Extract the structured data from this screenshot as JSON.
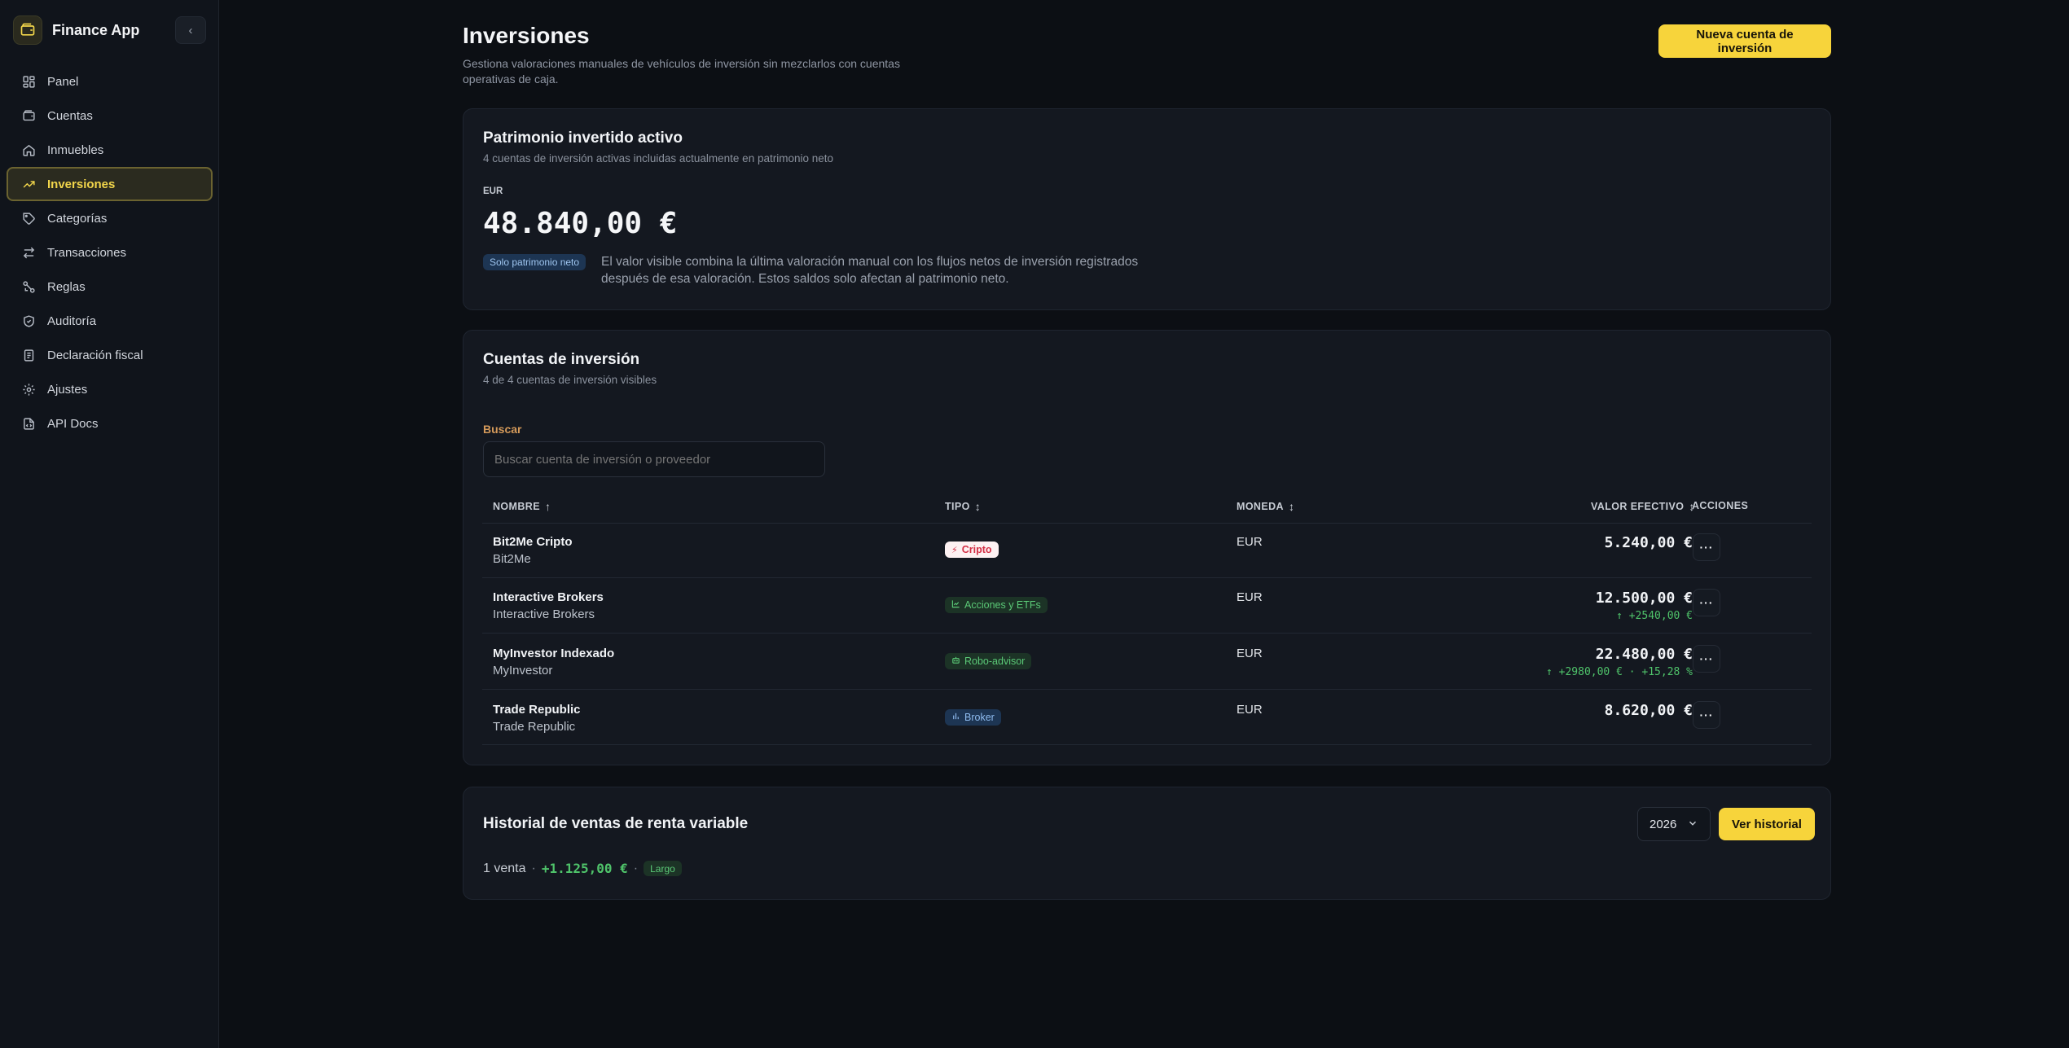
{
  "app": {
    "name": "Finance App",
    "collapse_icon": "‹"
  },
  "sidebar": {
    "items": [
      {
        "label": "Panel",
        "icon": "grid-icon"
      },
      {
        "label": "Cuentas",
        "icon": "wallet-icon"
      },
      {
        "label": "Inmuebles",
        "icon": "home-icon"
      },
      {
        "label": "Inversiones",
        "icon": "trending-up-icon",
        "active": true
      },
      {
        "label": "Categorías",
        "icon": "tag-icon"
      },
      {
        "label": "Transacciones",
        "icon": "arrows-swap-icon"
      },
      {
        "label": "Reglas",
        "icon": "workflow-icon"
      },
      {
        "label": "Auditoría",
        "icon": "shield-check-icon"
      },
      {
        "label": "Declaración fiscal",
        "icon": "receipt-icon"
      },
      {
        "label": "Ajustes",
        "icon": "gear-icon"
      },
      {
        "label": "API Docs",
        "icon": "file-code-icon"
      }
    ]
  },
  "header": {
    "title": "Inversiones",
    "subtitle": "Gestiona valoraciones manuales de vehículos de inversión sin mezclarlos con cuentas operativas de caja.",
    "new_button": "Nueva cuenta de inversión"
  },
  "summary": {
    "title": "Patrimonio invertido activo",
    "subtitle": "4 cuentas de inversión activas incluidas actualmente en patrimonio neto",
    "currency": "EUR",
    "total": "48.840,00 €",
    "badge": "Solo patrimonio neto",
    "note": "El valor visible combina la última valoración manual con los flujos netos de inversión registrados después de esa valoración. Estos saldos solo afectan al patrimonio neto."
  },
  "accounts": {
    "title": "Cuentas de inversión",
    "subtitle": "4 de 4 cuentas de inversión visibles",
    "search_label": "Buscar",
    "search_placeholder": "Buscar cuenta de inversión o proveedor",
    "columns": {
      "name": "NOMBRE",
      "name_sort": "↑",
      "type": "TIPO",
      "type_sort": "↕",
      "currency": "MONEDA",
      "currency_sort": "↕",
      "value": "VALOR EFECTIVO",
      "value_sort": "↕",
      "actions": "ACCIONES"
    },
    "rows": [
      {
        "name": "Bit2Me Cripto",
        "provider": "Bit2Me",
        "type": "Cripto",
        "type_icon": "⚡",
        "currency": "EUR",
        "value": "5.240,00 €",
        "delta": "",
        "actions": "···"
      },
      {
        "name": "Interactive Brokers",
        "provider": "Interactive Brokers",
        "type": "Acciones y ETFs",
        "type_icon": "📈",
        "currency": "EUR",
        "value": "12.500,00 €",
        "delta": "↑ +2540,00 €",
        "actions": "···"
      },
      {
        "name": "MyInvestor Indexado",
        "provider": "MyInvestor",
        "type": "Robo-advisor",
        "type_icon": "⚙",
        "currency": "EUR",
        "value": "22.480,00 €",
        "delta": "↑ +2980,00 € · +15,28 %",
        "actions": "···"
      },
      {
        "name": "Trade Republic",
        "provider": "Trade Republic",
        "type": "Broker",
        "type_icon": "▮",
        "currency": "EUR",
        "value": "8.620,00 €",
        "delta": "",
        "actions": "···"
      }
    ]
  },
  "history": {
    "title": "Historial de ventas de renta variable",
    "year": "2026",
    "button": "Ver historial",
    "count": "1 venta",
    "sep": "·",
    "amount": "+1.125,00 €",
    "term": "Largo"
  },
  "colors": {
    "accent": "#f7d43b",
    "positive": "#4fc36a",
    "crypto": "#e0344a",
    "info": "#7ab4f5"
  }
}
